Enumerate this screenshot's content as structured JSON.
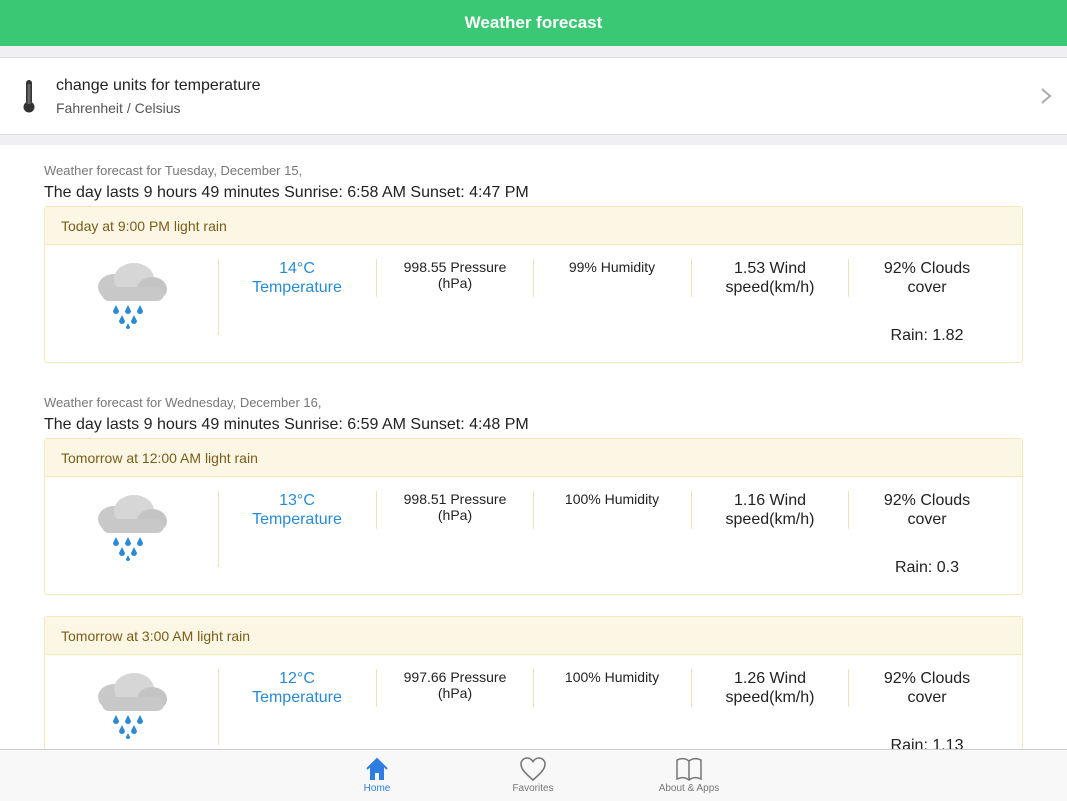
{
  "header": {
    "title": "Weather forecast"
  },
  "settings": {
    "title": "change units for temperature",
    "subtitle": "Fahrenheit / Celsius",
    "icon": "thermometer-icon"
  },
  "days": [
    {
      "label": "Weather forecast for Tuesday, December 15,",
      "info": "The day lasts 9 hours 49 minutes Sunrise: 6:58 AM Sunset: 4:47 PM"
    },
    {
      "label": "Weather forecast for Wednesday, December 16,",
      "info": "The day lasts 9 hours 49 minutes Sunrise: 6:59 AM Sunset: 4:48 PM"
    }
  ],
  "forecasts": [
    {
      "heading": "Today at 9:00 PM light rain",
      "icon": "rain-cloud-icon",
      "temp": "14°C",
      "temp_label": "Temperature",
      "pressure": "998.55 Pressure",
      "pressure_unit": "(hPa)",
      "humidity": "99% Humidity",
      "wind": "1.53 Wind",
      "wind_unit": "speed(km/h)",
      "clouds": "92% Clouds",
      "clouds_unit": "cover",
      "rain": "Rain: 1.82"
    },
    {
      "heading": "Tomorrow at 12:00 AM light rain",
      "icon": "rain-cloud-icon",
      "temp": "13°C",
      "temp_label": "Temperature",
      "pressure": "998.51 Pressure",
      "pressure_unit": "(hPa)",
      "humidity": "100% Humidity",
      "wind": "1.16 Wind",
      "wind_unit": "speed(km/h)",
      "clouds": "92% Clouds",
      "clouds_unit": "cover",
      "rain": "Rain: 0.3"
    },
    {
      "heading": "Tomorrow at 3:00 AM light rain",
      "icon": "rain-cloud-icon",
      "temp": "12°C",
      "temp_label": "Temperature",
      "pressure": "997.66 Pressure",
      "pressure_unit": "(hPa)",
      "humidity": "100% Humidity",
      "wind": "1.26 Wind",
      "wind_unit": "speed(km/h)",
      "clouds": "92% Clouds",
      "clouds_unit": "cover",
      "rain": "Rain: 1.13"
    }
  ],
  "tabs": [
    {
      "label": "Home",
      "icon": "home-icon",
      "active": true
    },
    {
      "label": "Favorites",
      "icon": "heart-icon",
      "active": false
    },
    {
      "label": "About & Apps",
      "icon": "book-icon",
      "active": false
    }
  ],
  "colors": {
    "header": "#3bc874",
    "accent": "#2f7de1",
    "temperature": "#2a8ad4"
  }
}
